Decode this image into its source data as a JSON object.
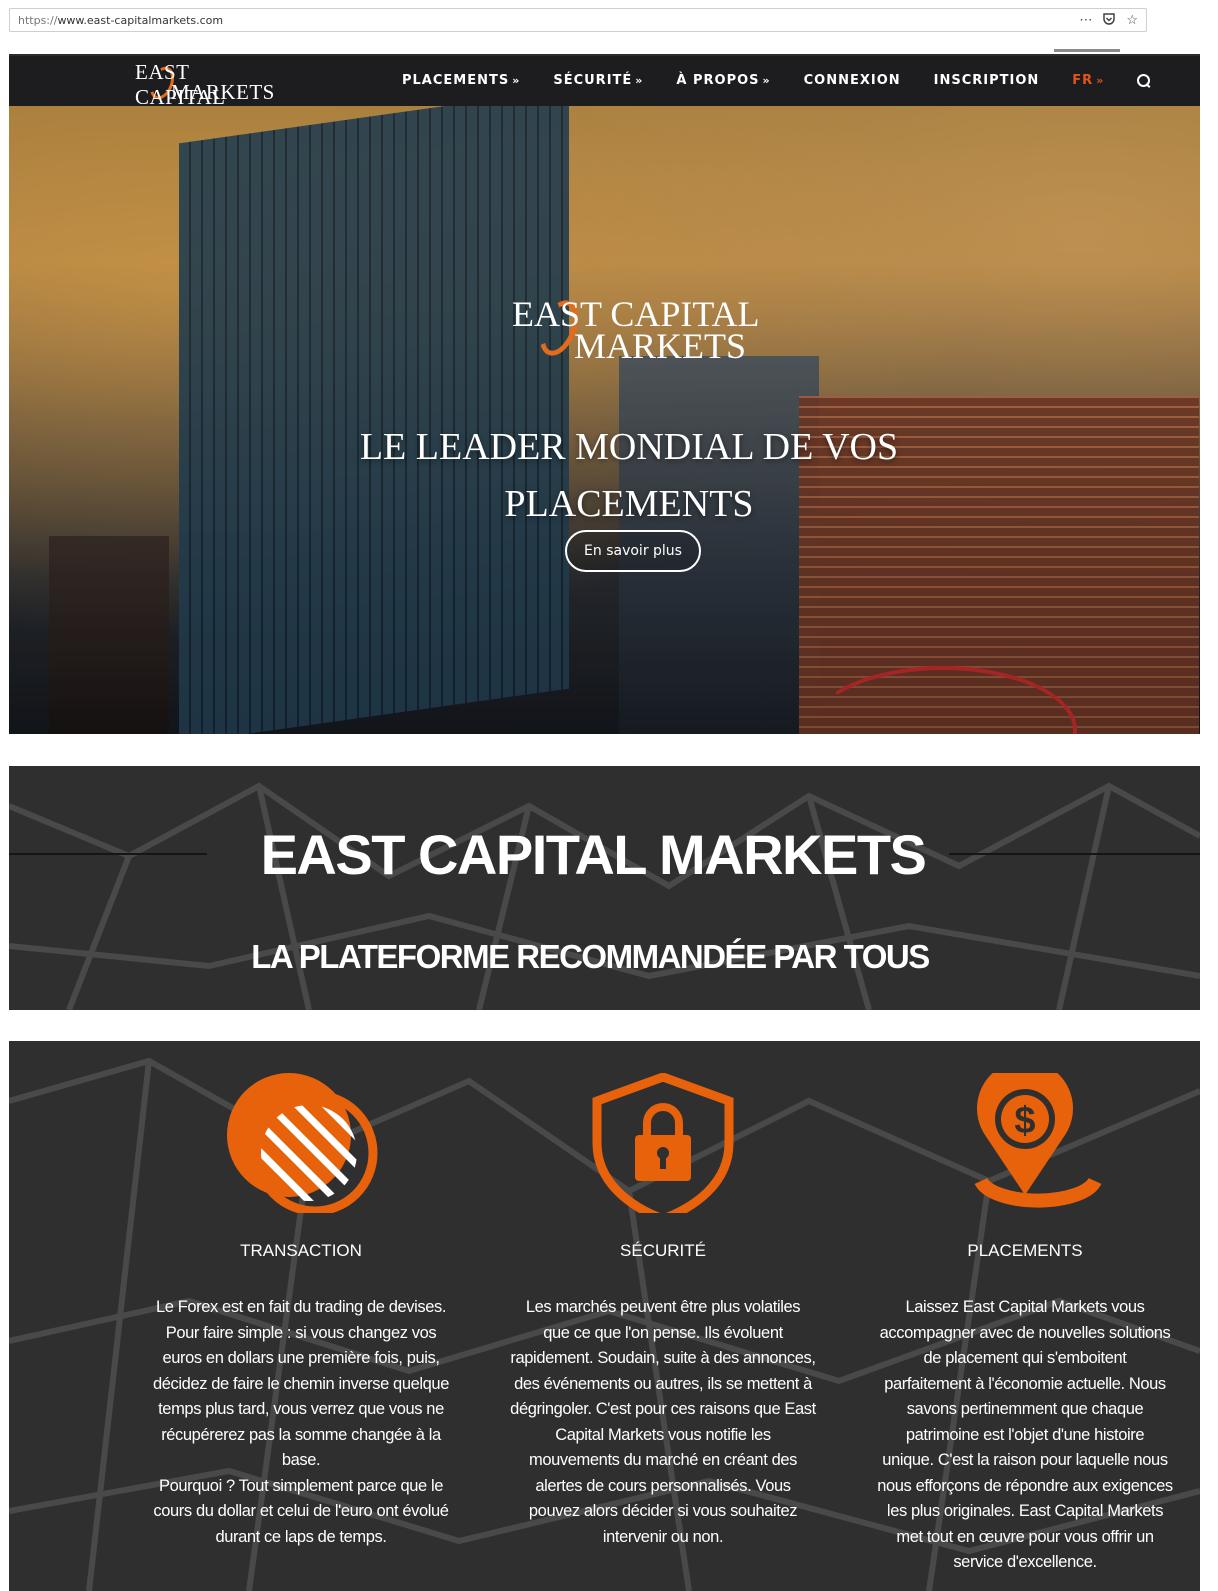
{
  "browser": {
    "url_protocol": "https://",
    "url_host": "www.east-capitalmarkets.com",
    "icons": [
      "more-icon",
      "pocket-icon",
      "bookmark-star-icon"
    ]
  },
  "header": {
    "logo_line1": "EAST CAPITAL",
    "logo_line2": "MARKETS",
    "nav": [
      {
        "label": "PLACEMENTS",
        "chevron": "»"
      },
      {
        "label": "SÉCURITÉ",
        "chevron": "»"
      },
      {
        "label": "À PROPOS",
        "chevron": "»"
      },
      {
        "label": "CONNEXION",
        "chevron": ""
      },
      {
        "label": "INSCRIPTION",
        "chevron": ""
      },
      {
        "label": "FR",
        "chevron": "»"
      }
    ],
    "accent_color": "#e2541c"
  },
  "hero": {
    "logo_line1": "EAST CAPITAL",
    "logo_line2": "MARKETS",
    "title_line1": "LE LEADER MONDIAL DE VOS",
    "title_line2": "PLACEMENTS",
    "button": "En savoir plus"
  },
  "band": {
    "title": "EAST CAPITAL MARKETS",
    "subtitle": "LA PLATEFORME RECOMMANDÉE PAR TOUS"
  },
  "features": [
    {
      "title": "TRANSACTION",
      "icon": "coins-icon",
      "lines": [
        "Le Forex est en fait du trading de devises.",
        "Pour faire simple : si vous changez vos",
        "euros en dollars une première fois, puis,",
        "décidez de faire le chemin inverse quelque",
        "temps plus tard, vous verrez que vous ne",
        "récupérerez pas la somme changée à la",
        "base.",
        "Pourquoi ? Tout simplement parce que le",
        "cours du dollar et celui de l'euro ont évolué",
        "durant ce laps de temps."
      ]
    },
    {
      "title": "SÉCURITÉ",
      "icon": "shield-lock-icon",
      "lines": [
        "Les marchés peuvent être plus volatiles",
        "que ce que l'on pense. Ils évoluent",
        "rapidement. Soudain, suite à des annonces,",
        "des événements ou autres, ils se mettent à",
        "dégringoler. C'est pour ces raisons que East",
        "Capital Markets vous notifie les",
        "mouvements du marché en créant des",
        "alertes de cours personnalisés. Vous",
        "pouvez alors décider si vous souhaitez",
        "intervenir ou non."
      ]
    },
    {
      "title": "PLACEMENTS",
      "icon": "dollar-pin-icon",
      "lines": [
        "Laissez East Capital Markets vous",
        "accompagner avec de nouvelles solutions",
        "de placement qui s'emboitent",
        "parfaitement à l'économie actuelle. Nous",
        "savons pertinemment que chaque",
        "patrimoine est l'objet d'une histoire",
        "unique. C'est la raison pour laquelle nous",
        "nous efforçons de répondre aux exigences",
        "les plus originales. East Capital Markets",
        "met tout en œuvre pour vous offrir un",
        "service d'excellence."
      ]
    }
  ]
}
